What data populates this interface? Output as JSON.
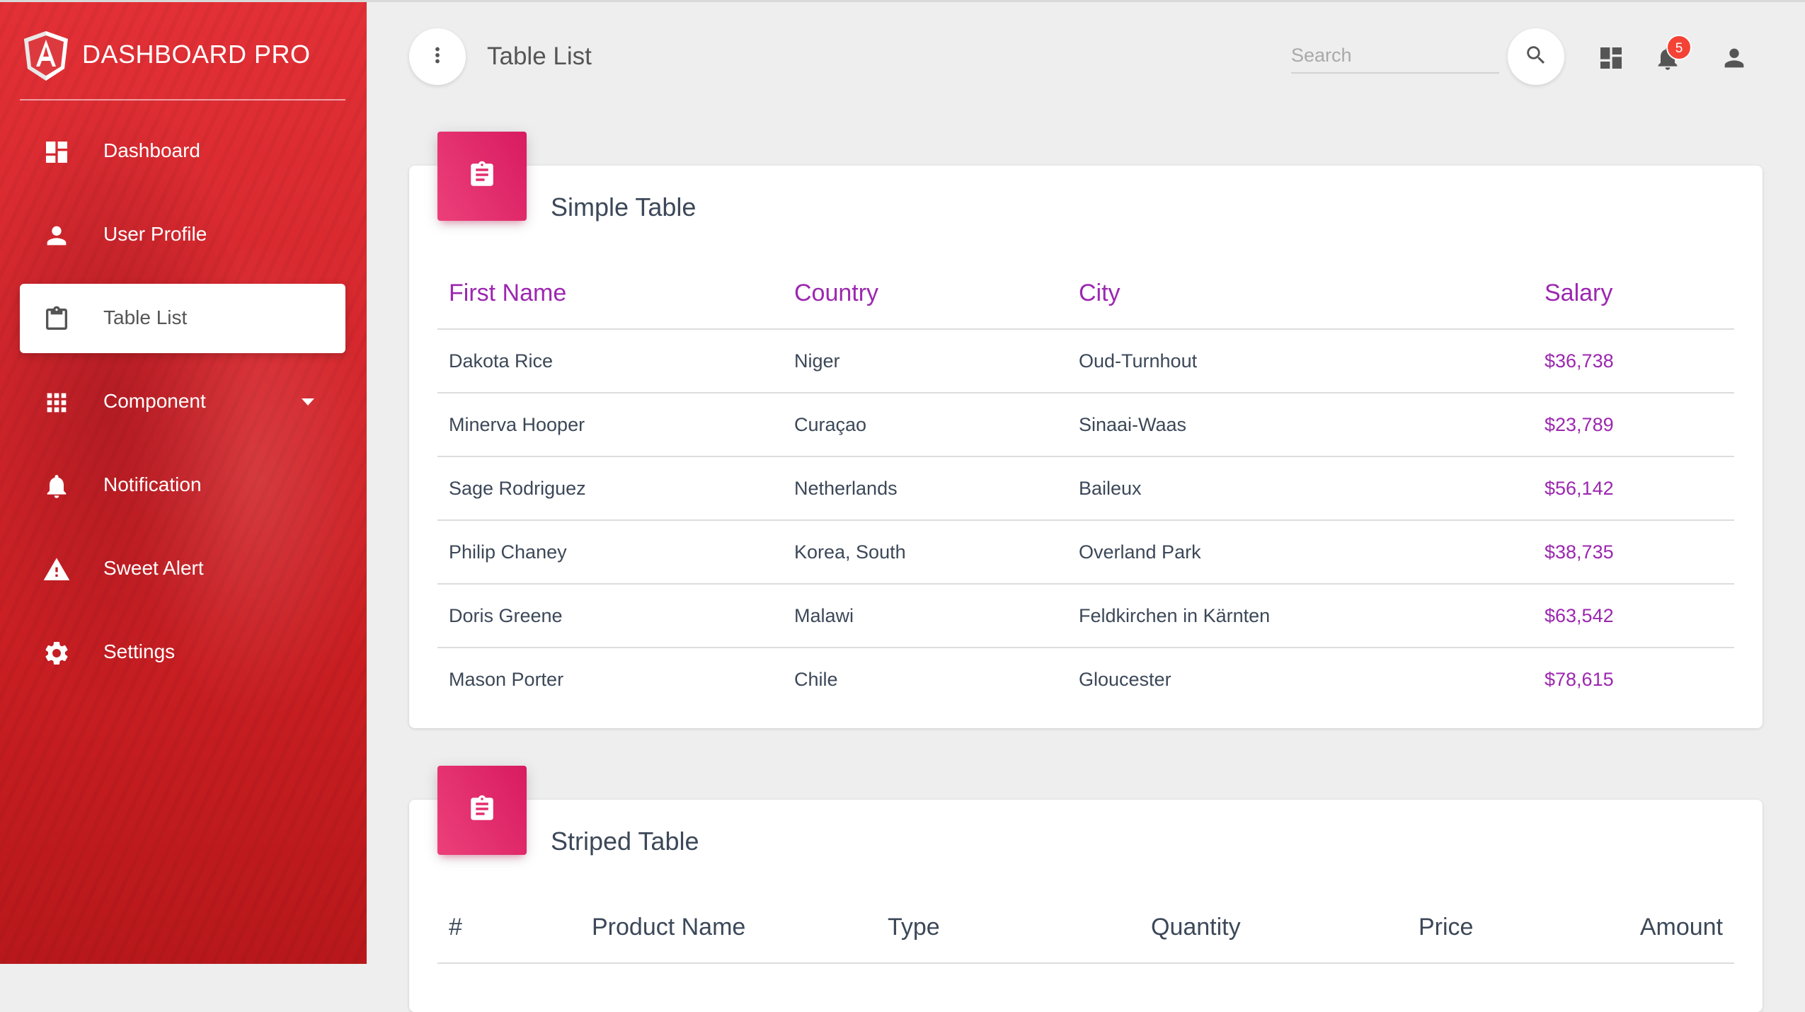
{
  "sidebar": {
    "brand": "DASHBOARD PRO",
    "items": [
      {
        "label": "Dashboard",
        "icon": "dashboard-icon"
      },
      {
        "label": "User Profile",
        "icon": "person-icon"
      },
      {
        "label": "Table List",
        "icon": "clipboard-icon",
        "active": true
      },
      {
        "label": "Component",
        "icon": "apps-grid-icon",
        "has_submenu": true
      },
      {
        "label": "Notification",
        "icon": "bell-icon"
      },
      {
        "label": "Sweet Alert",
        "icon": "warning-icon"
      },
      {
        "label": "Settings",
        "icon": "gear-icon"
      }
    ]
  },
  "navbar": {
    "title": "Table List",
    "search_placeholder": "Search",
    "notification_count": "5"
  },
  "simple_table": {
    "title": "Simple Table",
    "headers": [
      "First Name",
      "Country",
      "City",
      "Salary"
    ],
    "rows": [
      [
        "Dakota Rice",
        "Niger",
        "Oud-Turnhout",
        "$36,738"
      ],
      [
        "Minerva Hooper",
        "Curaçao",
        "Sinaai-Waas",
        "$23,789"
      ],
      [
        "Sage Rodriguez",
        "Netherlands",
        "Baileux",
        "$56,142"
      ],
      [
        "Philip Chaney",
        "Korea, South",
        "Overland Park",
        "$38,735"
      ],
      [
        "Doris Greene",
        "Malawi",
        "Feldkirchen in Kärnten",
        "$63,542"
      ],
      [
        "Mason Porter",
        "Chile",
        "Gloucester",
        "$78,615"
      ]
    ]
  },
  "striped_table": {
    "title": "Striped Table",
    "headers": [
      "#",
      "Product Name",
      "Type",
      "Quantity",
      "Price",
      "Amount"
    ]
  },
  "colors": {
    "sidebar_red": "#d6282e",
    "accent_purple": "#9c27b0",
    "card_icon_pink": "#e91e63",
    "badge_red": "#f44336"
  }
}
